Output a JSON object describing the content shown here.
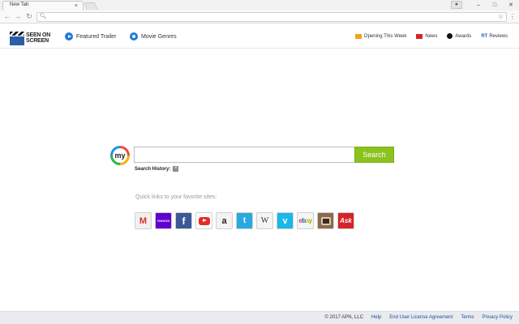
{
  "browser": {
    "tab_title": "New Tab",
    "tab_close": "×",
    "omnibox_value": "",
    "icons": {
      "back": "back-arrow-icon",
      "forward": "forward-arrow-icon",
      "reload": "reload-icon",
      "search": "search-icon",
      "bookmark": "star-icon",
      "menu": "menu-icon",
      "user": "user-icon"
    },
    "window_controls": {
      "minimize": "–",
      "maximize": "□",
      "close": "✕"
    }
  },
  "header": {
    "logo_lines": [
      "SEEN ON",
      "SCREEN"
    ],
    "featured_trailer": "Featured Trailer",
    "movie_genres": "Movie Genres",
    "right_links": {
      "opening": "Opening This Week",
      "news": "News",
      "awards": "Awards",
      "reviews_prefix": "RT",
      "reviews": "Reviews"
    }
  },
  "search": {
    "logo_text": "my",
    "input_value": "",
    "button_label": "Search",
    "history_label": "Search History:",
    "history_clear": "×"
  },
  "quick_links": {
    "label": "Quick links to your favorite sites:",
    "sites": [
      {
        "name": "Gmail",
        "glyph": "M"
      },
      {
        "name": "Yahoo",
        "glyph": "YAHOO!"
      },
      {
        "name": "Facebook",
        "glyph": "f"
      },
      {
        "name": "YouTube",
        "glyph": ""
      },
      {
        "name": "Amazon",
        "glyph": "a"
      },
      {
        "name": "Twitter",
        "glyph": "t"
      },
      {
        "name": "Wikipedia",
        "glyph": "W"
      },
      {
        "name": "Vimeo",
        "glyph": "v"
      },
      {
        "name": "eBay",
        "glyph": "ebay"
      },
      {
        "name": "Instagram",
        "glyph": ""
      },
      {
        "name": "Ask",
        "glyph": "Ask"
      }
    ]
  },
  "footer": {
    "copyright": "© 2017 APN, LLC",
    "help": "Help",
    "eula": "End User License Agreement",
    "terms": "Terms",
    "privacy": "Privacy Policy"
  },
  "colors": {
    "search_button": "#8ac21f",
    "footer_bg": "#e9ebef",
    "link_blue": "#1a4fa0"
  }
}
